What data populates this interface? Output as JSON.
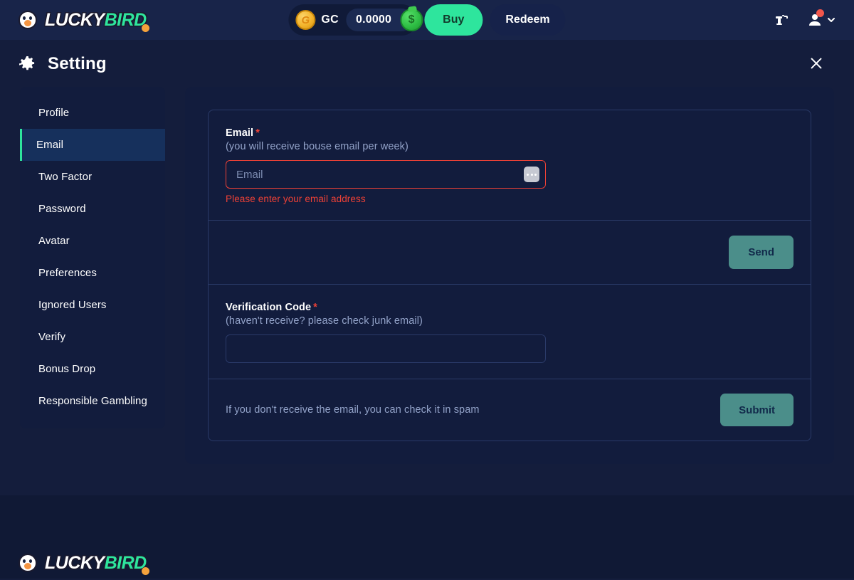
{
  "brand": {
    "name_part1": "LUCKY",
    "name_part2": "BIRD",
    "bird_icon": "bird-logo-icon"
  },
  "header": {
    "currency_icon": "gc-coin-icon",
    "currency_label": "GC",
    "balance": "0.0000",
    "money_bag_icon": "money-bag-icon",
    "buy_label": "Buy",
    "redeem_label": "Redeem",
    "faucet_icon": "faucet-icon",
    "user_icon": "user-avatar-icon",
    "chevron_icon": "chevron-down-icon",
    "notification_dot": "notification-dot"
  },
  "setting": {
    "gear_icon": "gear-icon",
    "title": "Setting",
    "close_icon": "close-icon"
  },
  "sidebar": {
    "items": [
      {
        "label": "Profile",
        "active": false
      },
      {
        "label": "Email",
        "active": true
      },
      {
        "label": "Two Factor",
        "active": false
      },
      {
        "label": "Password",
        "active": false
      },
      {
        "label": "Avatar",
        "active": false
      },
      {
        "label": "Preferences",
        "active": false
      },
      {
        "label": "Ignored Users",
        "active": false
      },
      {
        "label": "Verify",
        "active": false
      },
      {
        "label": "Bonus Drop",
        "active": false
      },
      {
        "label": "Responsible Gambling",
        "active": false
      }
    ]
  },
  "form": {
    "email": {
      "label": "Email",
      "required_marker": "*",
      "hint": "(you will receive bouse email per week)",
      "placeholder": "Email",
      "value": "",
      "error": "Please enter your email address",
      "autofill_icon": "autofill-dots-icon"
    },
    "send_label": "Send",
    "verification": {
      "label": "Verification Code",
      "required_marker": "*",
      "hint": "(haven't receive? please check junk email)",
      "placeholder": "",
      "value": ""
    },
    "spam_note": "If you don't receive the email, you can check it in spam",
    "submit_label": "Submit"
  },
  "colors": {
    "page_bg": "#141d3c",
    "header_bg": "#182449",
    "panel_bg": "#121c3d",
    "accent_green": "#2ee59d",
    "error_red": "#ef4136",
    "button_teal": "#4b8e8a",
    "muted_text": "#93a3c9",
    "border": "#2a3a68",
    "active_item_bg": "#16305c",
    "footer_bg": "#101935"
  }
}
